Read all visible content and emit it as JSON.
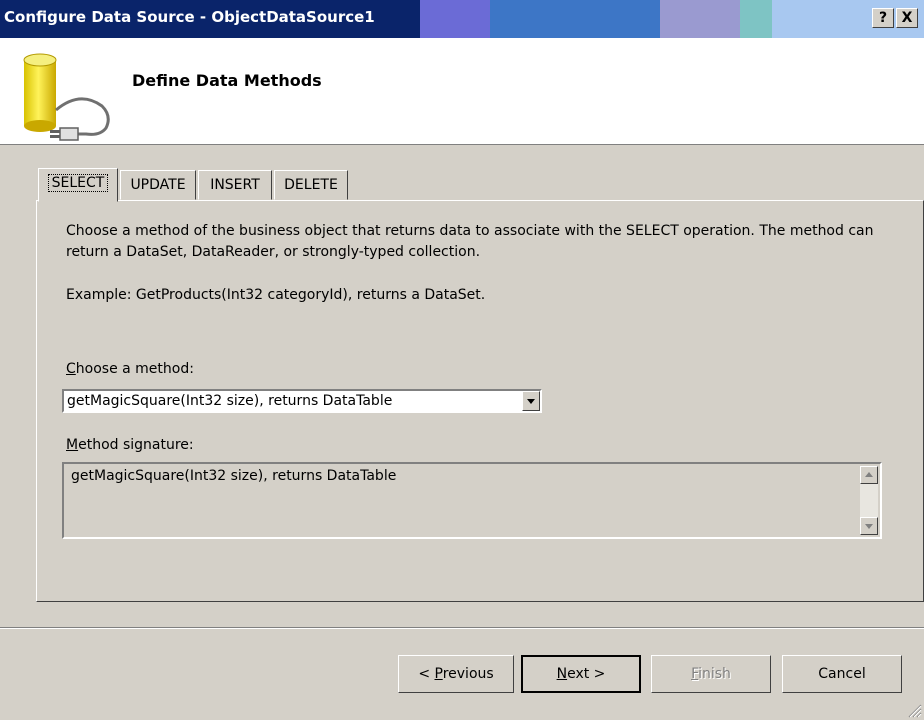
{
  "window": {
    "title": "Configure Data Source - ObjectDataSource1",
    "help_label": "?",
    "close_label": "X"
  },
  "header": {
    "title": "Define Data Methods",
    "icon": "database-plug-icon"
  },
  "tabs": [
    {
      "label": "SELECT",
      "active": true
    },
    {
      "label": "UPDATE",
      "active": false
    },
    {
      "label": "INSERT",
      "active": false
    },
    {
      "label": "DELETE",
      "active": false
    }
  ],
  "panel": {
    "description": "Choose a method of the business object that returns data to associate with the SELECT operation. The method can return a DataSet, DataReader, or strongly-typed collection.",
    "example": "Example: GetProducts(Int32 categoryId), returns a DataSet.",
    "method_label_first": "C",
    "method_label_rest": "hoose a method:",
    "method_value": "getMagicSquare(Int32 size), returns DataTable",
    "signature_label_first": "M",
    "signature_label_rest": "ethod signature:",
    "signature_value": "getMagicSquare(Int32 size), returns DataTable"
  },
  "buttons": {
    "previous_prefix": "< ",
    "previous_key": "P",
    "previous_rest": "revious",
    "next_key": "N",
    "next_rest": "ext >",
    "finish_key": "F",
    "finish_rest": "inish",
    "cancel": "Cancel"
  }
}
